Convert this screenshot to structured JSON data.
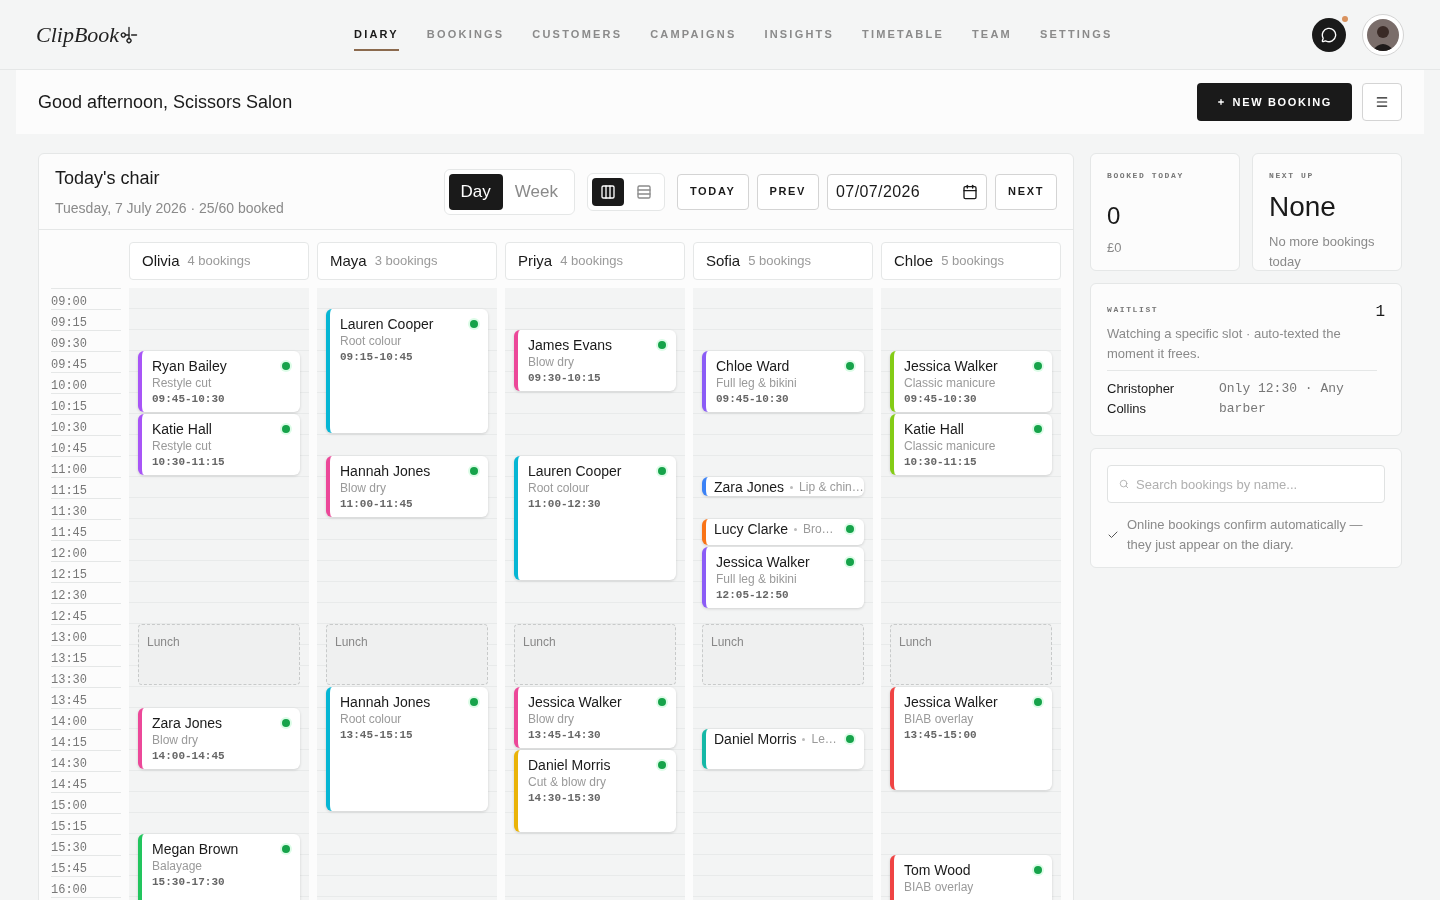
{
  "brand": {
    "logo": "ClipBook"
  },
  "nav": [
    {
      "label": "DIARY",
      "selected": true
    },
    {
      "label": "BOOKINGS",
      "selected": false
    },
    {
      "label": "CUSTOMERS",
      "selected": false
    },
    {
      "label": "CAMPAIGNS",
      "selected": false
    },
    {
      "label": "INSIGHTS",
      "selected": false
    },
    {
      "label": "TIMETABLE",
      "selected": false
    },
    {
      "label": "TEAM",
      "selected": false
    },
    {
      "label": "SETTINGS",
      "selected": false
    }
  ],
  "chat": {
    "notification": true
  },
  "header": {
    "greeting": "Good afternoon, Scissors Salon",
    "new_booking": "NEW BOOKING"
  },
  "diary": {
    "title": "Today's chair",
    "subtitle": "Tuesday, 7 July 2026 · 25/60 booked",
    "view_toggle": [
      {
        "label": "Day",
        "selected": true
      },
      {
        "label": "Week",
        "selected": false
      }
    ],
    "layout_toggle": [
      {
        "kind": "columns",
        "selected": true
      },
      {
        "kind": "list",
        "selected": false
      }
    ],
    "today": "TODAY",
    "prev": "PREV",
    "date": "07/07/2026",
    "next": "NEXT",
    "times": [
      "09:00",
      "09:15",
      "09:30",
      "09:45",
      "10:00",
      "10:15",
      "10:30",
      "10:45",
      "11:00",
      "11:15",
      "11:30",
      "11:45",
      "12:00",
      "12:15",
      "12:30",
      "12:45",
      "13:00",
      "13:15",
      "13:30",
      "13:45",
      "14:00",
      "14:15",
      "14:30",
      "14:45",
      "15:00",
      "15:15",
      "15:30",
      "15:45",
      "16:00"
    ],
    "staff": [
      {
        "name": "Olivia",
        "count": "4 bookings",
        "breaks": [
          {
            "label": "Lunch"
          }
        ],
        "bookings": [
          {
            "kind": "full",
            "name": "Ryan Bailey",
            "service": "Restyle cut",
            "time": "09:45-10:30",
            "color": "#a855f7",
            "confirmed": true
          },
          {
            "kind": "full",
            "name": "Katie Hall",
            "service": "Restyle cut",
            "time": "10:30-11:15",
            "color": "#a855f7",
            "confirmed": true
          },
          {
            "kind": "full",
            "name": "Zara Jones",
            "service": "Blow dry",
            "time": "14:00-14:45",
            "color": "#ec4899",
            "confirmed": true
          },
          {
            "kind": "full",
            "name": "Megan Brown",
            "service": "Balayage",
            "time": "15:30-17:30",
            "color": "#22c55e",
            "confirmed": true
          }
        ]
      },
      {
        "name": "Maya",
        "count": "3 bookings",
        "breaks": [
          {
            "label": "Lunch"
          }
        ],
        "bookings": [
          {
            "kind": "full",
            "name": "Lauren Cooper",
            "service": "Root colour",
            "time": "09:15-10:45",
            "color": "#06b6d4",
            "confirmed": true
          },
          {
            "kind": "full",
            "name": "Hannah Jones",
            "service": "Blow dry",
            "time": "11:00-11:45",
            "color": "#ec4899",
            "confirmed": true
          },
          {
            "kind": "full",
            "name": "Hannah Jones",
            "service": "Root colour",
            "time": "13:45-15:15",
            "color": "#06b6d4",
            "confirmed": true
          }
        ]
      },
      {
        "name": "Priya",
        "count": "4 bookings",
        "breaks": [
          {
            "label": "Lunch"
          }
        ],
        "bookings": [
          {
            "kind": "full",
            "name": "James Evans",
            "service": "Blow dry",
            "time": "09:30-10:15",
            "color": "#ec4899",
            "confirmed": true
          },
          {
            "kind": "full",
            "name": "Lauren Cooper",
            "service": "Root colour",
            "time": "11:00-12:30",
            "color": "#06b6d4",
            "confirmed": true
          },
          {
            "kind": "full",
            "name": "Jessica Walker",
            "service": "Blow dry",
            "time": "13:45-14:30",
            "color": "#ec4899",
            "confirmed": true
          },
          {
            "kind": "full",
            "name": "Daniel Morris",
            "service": "Cut & blow dry",
            "time": "14:30-15:30",
            "color": "#eab308",
            "confirmed": true
          }
        ]
      },
      {
        "name": "Sofia",
        "count": "5 bookings",
        "breaks": [
          {
            "label": "Lunch"
          }
        ],
        "bookings": [
          {
            "kind": "full",
            "name": "Chloe Ward",
            "service": "Full leg & bikini",
            "time": "09:45-10:30",
            "color": "#8b5cf6",
            "confirmed": true
          },
          {
            "kind": "compact",
            "name": "Zara Jones",
            "service": "Lip & chin…",
            "color": "#3b82f6",
            "confirmed": false
          },
          {
            "kind": "compact",
            "name": "Lucy Clarke",
            "service": "Bro…",
            "color": "#f97316",
            "confirmed": true
          },
          {
            "kind": "full",
            "name": "Jessica Walker",
            "service": "Full leg & bikini",
            "time": "12:05-12:50",
            "color": "#8b5cf6",
            "confirmed": true
          },
          {
            "kind": "compact",
            "name": "Daniel Morris",
            "service": "Le…",
            "color": "#14b8a6",
            "confirmed": true
          }
        ]
      },
      {
        "name": "Chloe",
        "count": "5 bookings",
        "breaks": [
          {
            "label": "Lunch"
          }
        ],
        "bookings": [
          {
            "kind": "full",
            "name": "Jessica Walker",
            "service": "Classic manicure",
            "time": "09:45-10:30",
            "color": "#84cc16",
            "confirmed": true
          },
          {
            "kind": "full",
            "name": "Katie Hall",
            "service": "Classic manicure",
            "time": "10:30-11:15",
            "color": "#84cc16",
            "confirmed": true
          },
          {
            "kind": "full",
            "name": "Jessica Walker",
            "service": "BIAB overlay",
            "time": "13:45-15:00",
            "color": "#ef4444",
            "confirmed": true
          },
          {
            "kind": "full",
            "name": "Tom Wood",
            "service": "BIAB overlay",
            "color": "#ef4444",
            "confirmed": true
          }
        ]
      }
    ]
  },
  "stats": [
    {
      "label": "BOOKED TODAY",
      "value": "0",
      "sub": "£0"
    },
    {
      "label": "NEXT UP",
      "value": "None",
      "sub": "No more bookings today"
    }
  ],
  "waitlist": {
    "label": "WAITLIST",
    "count": "1",
    "description": "Watching a specific slot · auto-texted the moment it frees.",
    "entries": [
      {
        "name": "Christopher Collins",
        "note": "Only 12:30 · Any barber"
      }
    ]
  },
  "search": {
    "placeholder": "Search bookings by name..."
  },
  "note": "Online bookings confirm automatically — they just appear on the diary."
}
